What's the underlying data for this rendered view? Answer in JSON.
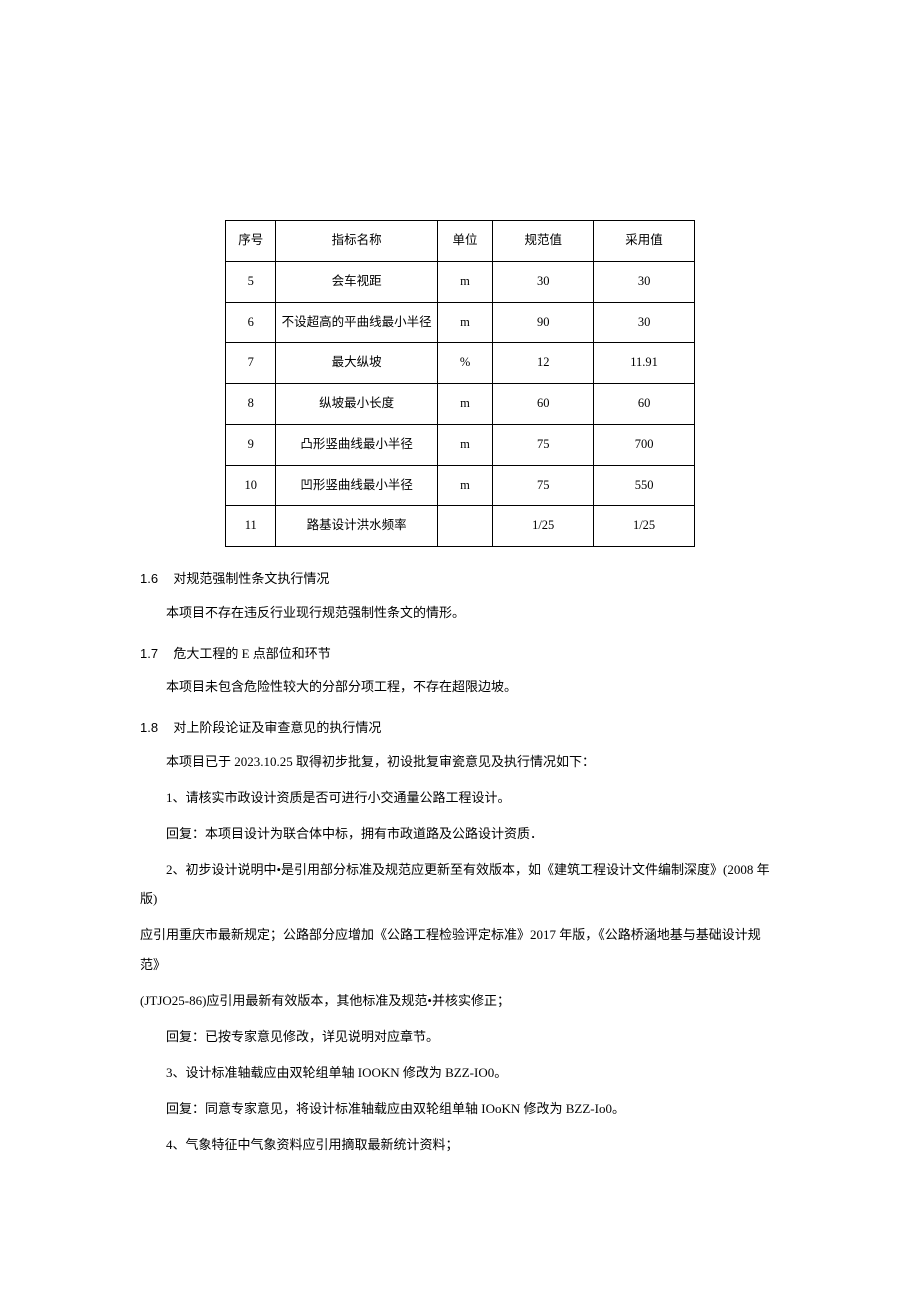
{
  "table": {
    "headers": {
      "seq": "序号",
      "name": "指标名称",
      "unit": "单位",
      "spec": "规范值",
      "use": "采用值"
    },
    "rows": [
      {
        "seq": "5",
        "name": "会车视距",
        "unit": "m",
        "spec": "30",
        "use": "30"
      },
      {
        "seq": "6",
        "name": "不设超高的平曲线最小半径",
        "unit": "m",
        "spec": "90",
        "use": "30"
      },
      {
        "seq": "7",
        "name": "最大纵坡",
        "unit": "%",
        "spec": "12",
        "use": "11.91"
      },
      {
        "seq": "8",
        "name": "纵坡最小长度",
        "unit": "m",
        "spec": "60",
        "use": "60"
      },
      {
        "seq": "9",
        "name": "凸形竖曲线最小半径",
        "unit": "m",
        "spec": "75",
        "use": "700"
      },
      {
        "seq": "10",
        "name": "凹形竖曲线最小半径",
        "unit": "m",
        "spec": "75",
        "use": "550"
      },
      {
        "seq": "11",
        "name": "路基设计洪水频率",
        "unit": "",
        "spec": "1/25",
        "use": "1/25"
      }
    ]
  },
  "sections": {
    "s16": {
      "num": "1.6",
      "title": "对规范强制性条文执行情况",
      "p1": "本项目不存在违反行业现行规范强制性条文的情形。"
    },
    "s17": {
      "num": "1.7",
      "title": "危大工程的 E 点部位和环节",
      "p1": "本项目未包含危险性较大的分部分项工程，不存在超限边坡。"
    },
    "s18": {
      "num": "1.8",
      "title": "对上阶段论证及审查意见的执行情况",
      "p1": "本项目已于 2023.10.25 取得初步批复，初设批复审瓷意见及执行情况如下：",
      "p2": "1、请核实市政设计资质是否可进行小交通量公路工程设计。",
      "p3": "回复：本项目设计为联合体中标，拥有市政道路及公路设计资质．",
      "p4": "2、初步设计说明中•是引用部分标准及规范应更新至有效版本，如《建筑工程设计文件编制深度》(2008 年版)",
      "p4b": "应引用重庆市最新规定；公路部分应增加《公路工程检验评定标准》2017 年版，《公路桥涵地基与基础设计规范》",
      "p4c": "(JTJO25-86)应引用最新有效版本，其他标准及规范•并核实修正；",
      "p5": "回复：已按专家意见修改，详见说明对应章节。",
      "p6": "3、设计标准轴载应由双轮组单轴 IOOKN 修改为 BZZ-IO0。",
      "p7": "回复：同意专家意见，将设计标准轴载应由双轮组单轴 IOoKN 修改为 BZZ-Io0。",
      "p8": "4、气象特征中气象资料应引用摘取最新统计资料；"
    }
  }
}
